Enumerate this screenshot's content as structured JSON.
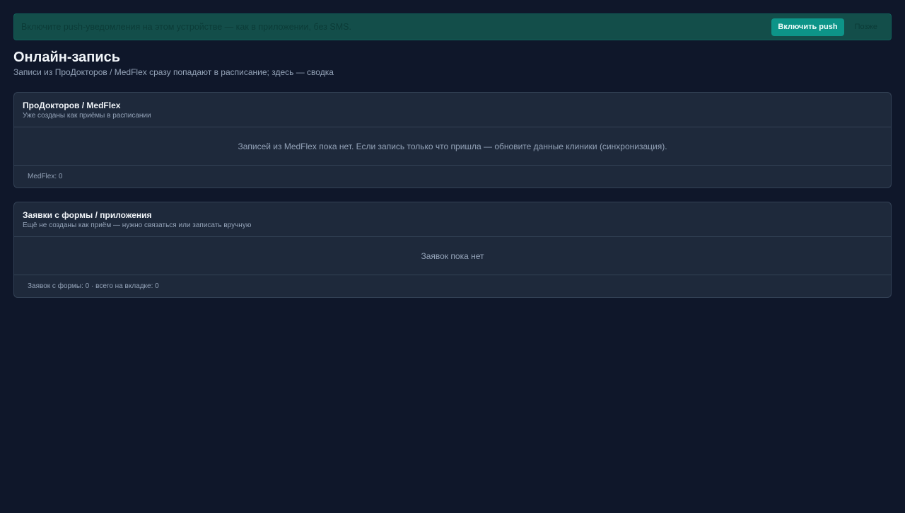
{
  "banner": {
    "text": "Включите push-уведомления на этом устройстве — как в приложении, без SMS.",
    "enable_label": "Включить push",
    "later_label": "Позже"
  },
  "header": {
    "title": "Онлайн-запись",
    "subtitle": "Записи из ПроДокторов / MedFlex сразу попадают в расписание; здесь — сводка"
  },
  "cards": [
    {
      "title": "ПроДокторов / MedFlex",
      "subtitle": "Уже созданы как приёмы в расписании",
      "empty_text": "Записей из MedFlex пока нет. Если запись только что пришла — обновите данные клиники (синхронизация).",
      "footer": "MedFlex: 0"
    },
    {
      "title": "Заявки с формы / приложения",
      "subtitle": "Ещё не созданы как приём — нужно связаться или записать вручную",
      "empty_text": "Заявок пока нет",
      "footer": "Заявок с формы: 0 · всего на вкладке: 0"
    }
  ],
  "colors": {
    "background": "#0f172a",
    "card": "#1e293b",
    "banner": "#134e4a",
    "accent": "#0d9488"
  }
}
